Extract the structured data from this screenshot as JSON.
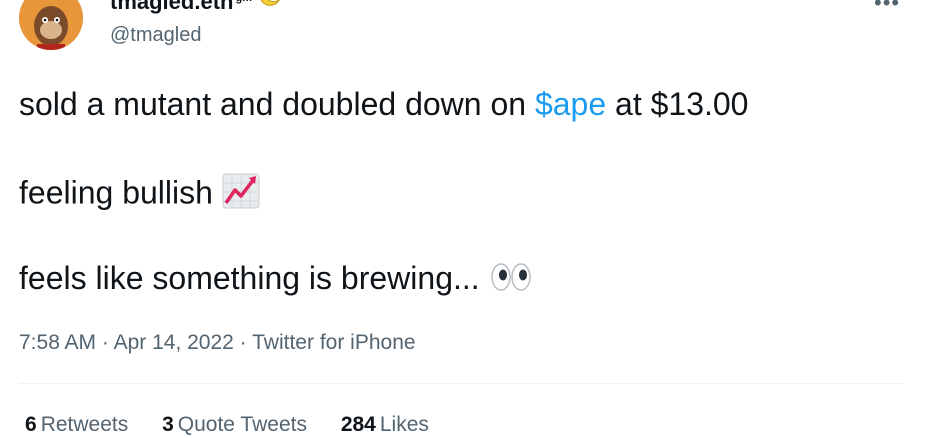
{
  "author": {
    "display_name": "tmagled.eth",
    "name_suffix": "gm",
    "handle": "@tmagled",
    "avatar_icon": "bored-ape-avatar",
    "name_emoji_icon": "banana-icon"
  },
  "more_icon": "more-options-icon",
  "tweet": {
    "line1_pre": "sold a mutant and doubled down on ",
    "line1_cashtag": "$ape",
    "line1_post": " at $13.00",
    "line2": "feeling bullish",
    "line2_icon": "chart-increasing-icon",
    "line3": "feels like something is brewing...",
    "line3_icon": "eyes-icon"
  },
  "meta": {
    "time": "7:58 AM",
    "sep": " · ",
    "date": "Apr 14, 2022",
    "source": "Twitter for iPhone"
  },
  "stats": {
    "retweets_count": "6",
    "retweets_label": "Retweets",
    "quotes_count": "3",
    "quotes_label": "Quote Tweets",
    "likes_count": "284",
    "likes_label": "Likes"
  },
  "colors": {
    "link": "#1d9bf0",
    "secondary": "#536471",
    "primary": "#0f1419",
    "divider": "#eff3f4"
  }
}
